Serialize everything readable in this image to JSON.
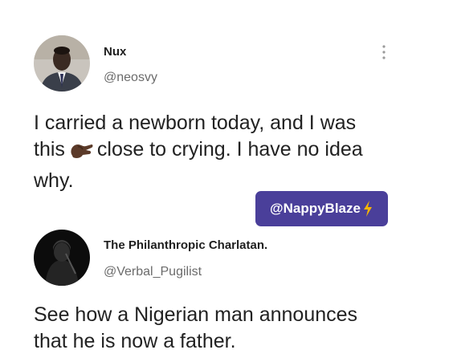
{
  "tweets": [
    {
      "display_name": "Nux",
      "handle": "@neosvy",
      "text_lines": [
        "I carried a newborn today, and I was",
        "close to crying. I have no idea",
        "why."
      ],
      "text_prefix": "this",
      "emoji": "pinching-hand",
      "menu_icon": "more-vertical-icon"
    },
    {
      "display_name": "The Philanthropic Charlatan.",
      "handle": "@Verbal_Pugilist",
      "text_lines": [
        "See how a Nigerian man announces",
        "that he is now a father."
      ]
    }
  ],
  "watermark": {
    "label": "@NappyBlaze",
    "icon": "lightning-icon",
    "background": "#4a3f9a",
    "icon_color": "#f7b500"
  }
}
